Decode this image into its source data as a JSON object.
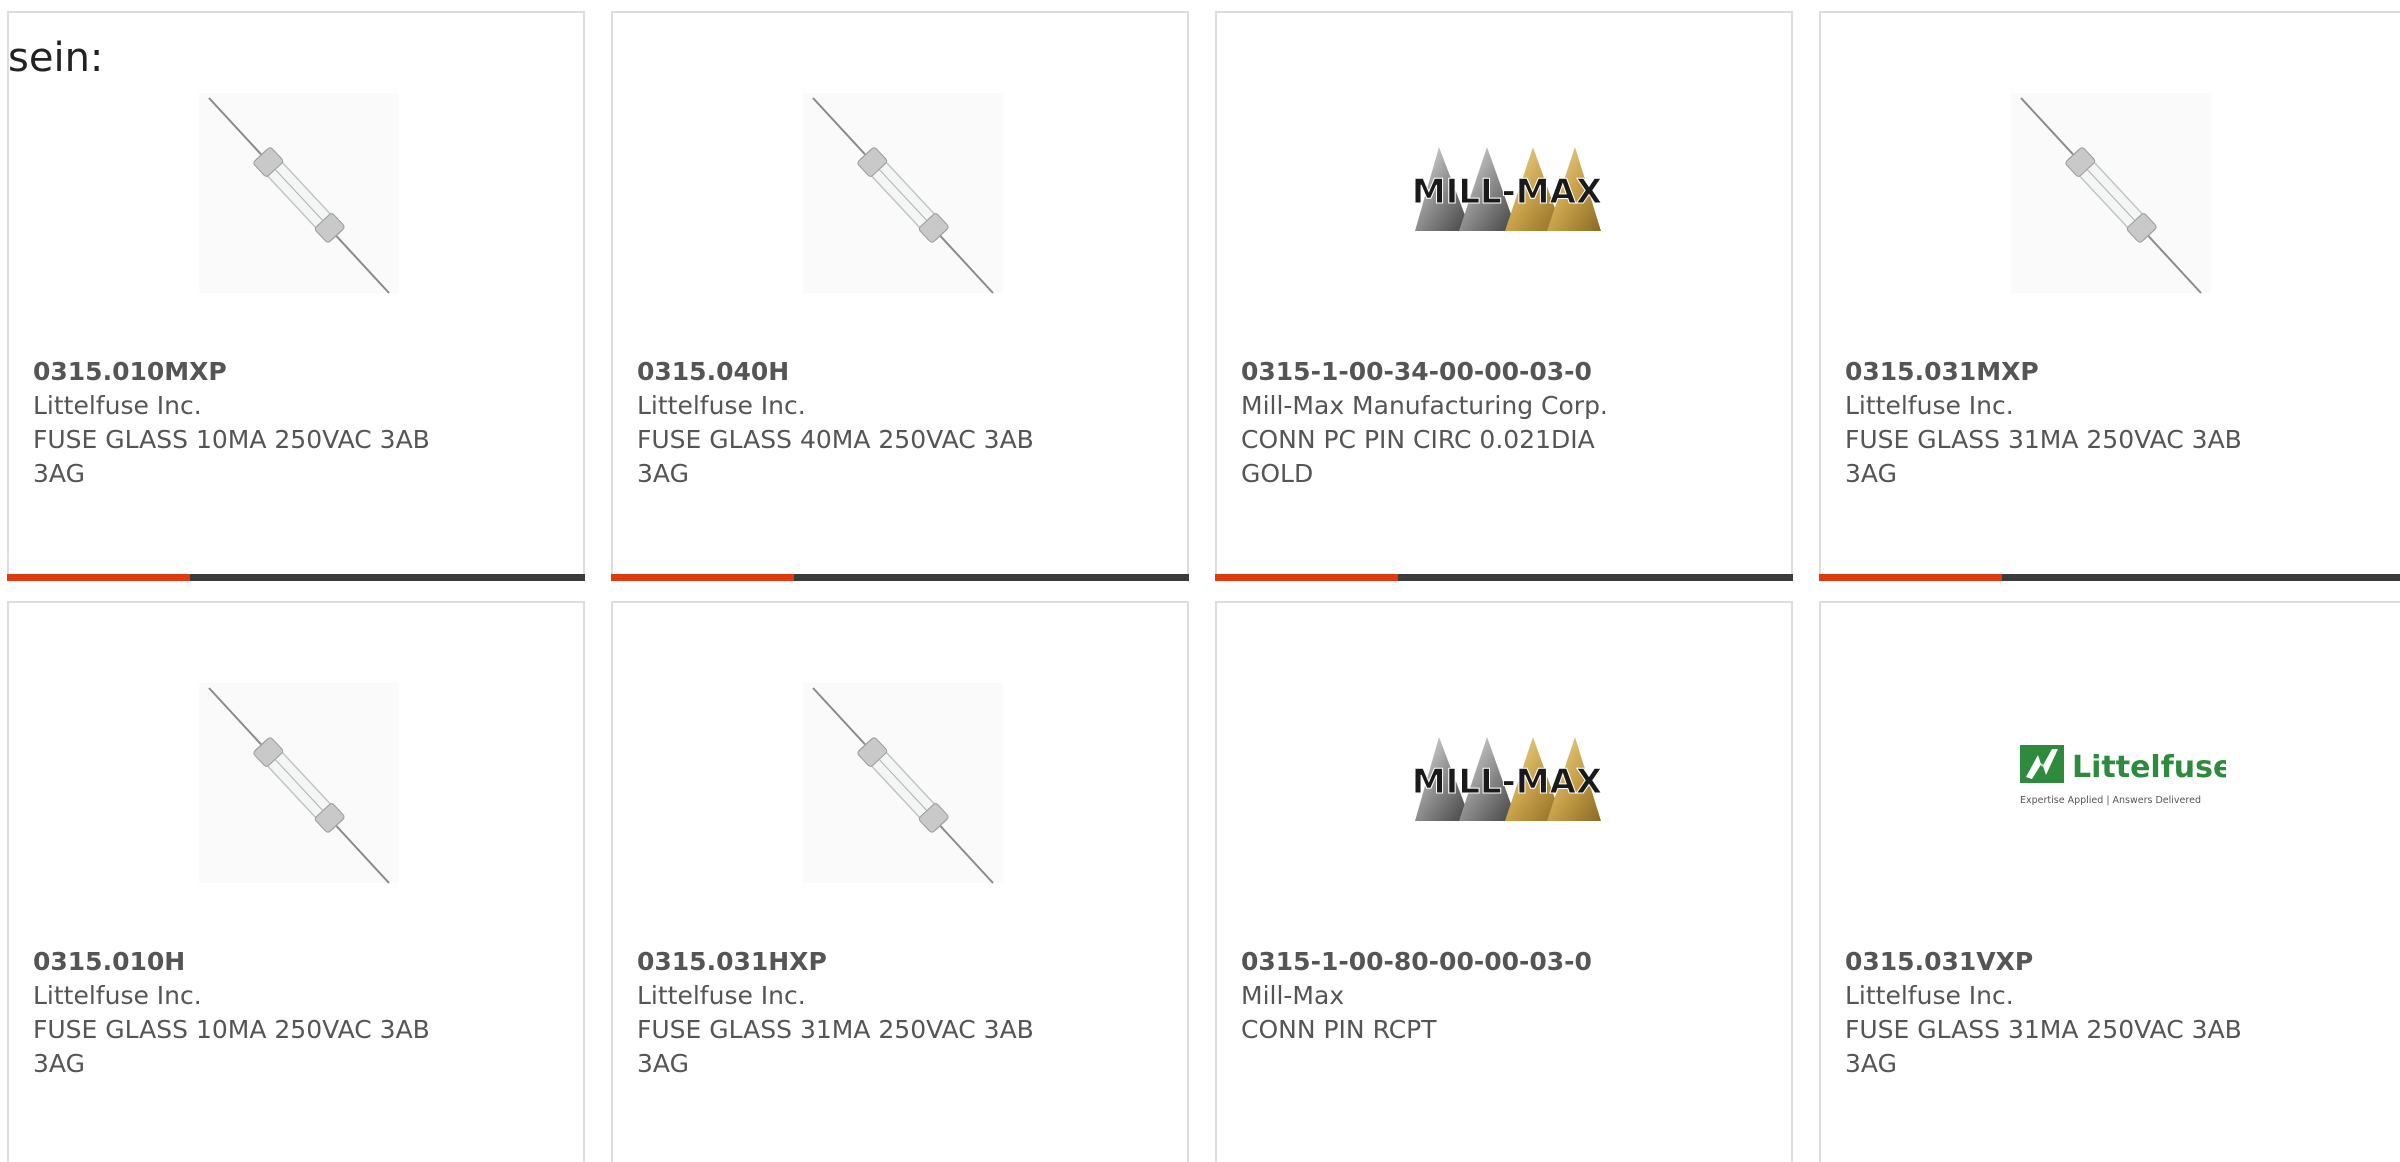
{
  "heading": "sein:",
  "colors": {
    "accent": "#e03a10",
    "bar": "#3b3b3b",
    "text": "#555555",
    "border": "#dddddd",
    "littelfuse_green": "#2e8b3e"
  },
  "cards": [
    {
      "part": "0315.010MXP",
      "manufacturer": "Littelfuse Inc.",
      "description": "FUSE GLASS 10MA 250VAC 3AB 3AG",
      "image": "glass-fuse-image"
    },
    {
      "part": "0315.040H",
      "manufacturer": "Littelfuse Inc.",
      "description": "FUSE GLASS 40MA 250VAC 3AB 3AG",
      "image": "glass-fuse-image"
    },
    {
      "part": "0315-1-00-34-00-00-03-0",
      "manufacturer": "Mill-Max Manufacturing Corp.",
      "description": "CONN PC PIN CIRC 0.021DIA GOLD",
      "image": "mill-max-logo",
      "logo_text": "MILL-MAX"
    },
    {
      "part": "0315.031MXP",
      "manufacturer": "Littelfuse Inc.",
      "description": "FUSE GLASS 31MA 250VAC 3AB 3AG",
      "image": "glass-fuse-image"
    },
    {
      "part": "0315.010H",
      "manufacturer": "Littelfuse Inc.",
      "description": "FUSE GLASS 10MA 250VAC 3AB 3AG",
      "image": "glass-fuse-image"
    },
    {
      "part": "0315.031HXP",
      "manufacturer": "Littelfuse Inc.",
      "description": "FUSE GLASS 31MA 250VAC 3AB 3AG",
      "image": "glass-fuse-image"
    },
    {
      "part": "0315-1-00-80-00-00-03-0",
      "manufacturer": "Mill-Max",
      "description": "CONN PIN RCPT",
      "image": "mill-max-logo",
      "logo_text": "MILL-MAX"
    },
    {
      "part": "0315.031VXP",
      "manufacturer": "Littelfuse Inc.",
      "description": "FUSE GLASS 31MA 250VAC 3AB 3AG",
      "image": "littelfuse-logo",
      "logo_text": "Littelfuse",
      "logo_tagline": "Expertise Applied | Answers Delivered"
    }
  ]
}
